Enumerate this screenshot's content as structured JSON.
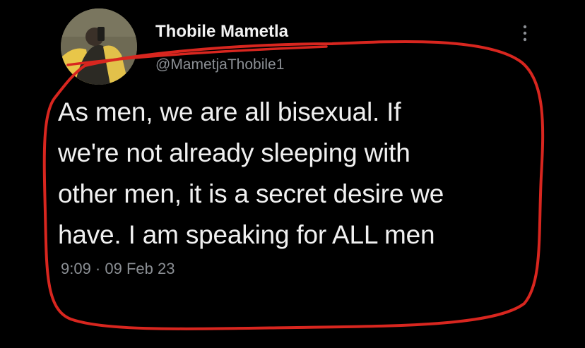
{
  "tweet": {
    "display_name": "Thobile Mametla",
    "handle": "@MametjaThobile1",
    "text": "As men, we are all bisexual. If\nwe're not already sleeping with\nother men, it is a secret desire we\nhave. I am speaking for ALL men",
    "timestamp": "9:09 · 09 Feb 23"
  },
  "icons": {
    "more": "more-vertical-icon",
    "avatar": "profile-photo"
  },
  "colors": {
    "background": "#000000",
    "text": "#f0f0f0",
    "secondary_text": "#8b8f94",
    "annotation": "#d8261f"
  }
}
